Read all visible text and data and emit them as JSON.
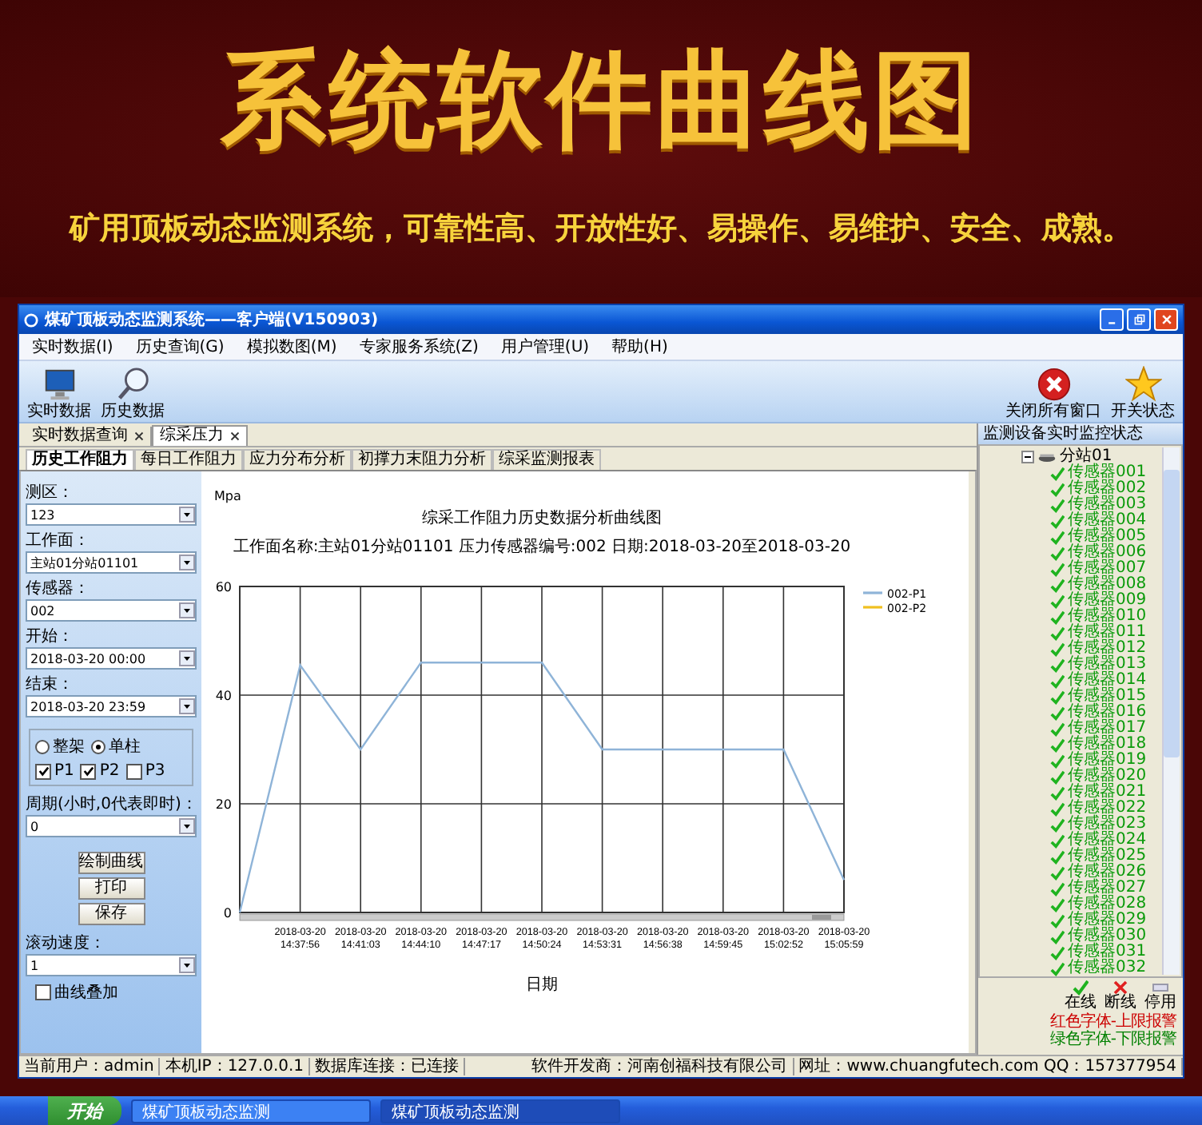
{
  "banner": {
    "title": "系统软件曲线图",
    "subtitle": "矿用顶板动态监测系统，可靠性高、开放性好、易操作、易维护、安全、成熟。"
  },
  "window": {
    "title": "煤矿顶板动态监测系统——客户端(V150903)"
  },
  "menu": [
    "实时数据(I)",
    "历史查询(G)",
    "模拟数图(M)",
    "专家服务系统(Z)",
    "用户管理(U)",
    "帮助(H)"
  ],
  "toolbar": {
    "left": [
      "实时数据",
      "历史数据"
    ],
    "right": [
      "关闭所有窗口",
      "开关状态"
    ]
  },
  "doc_tabs": [
    {
      "label": "实时数据查询",
      "selected": false
    },
    {
      "label": "综采压力",
      "selected": true
    }
  ],
  "sub_tabs": [
    {
      "label": "历史工作阻力",
      "selected": true
    },
    {
      "label": "每日工作阻力",
      "selected": false
    },
    {
      "label": "应力分布分析",
      "selected": false
    },
    {
      "label": "初撑力末阻力分析",
      "selected": false
    },
    {
      "label": "综采监测报表",
      "selected": false
    }
  ],
  "query_form": [
    {
      "kind": "select",
      "label": "测区：",
      "value": "123"
    },
    {
      "kind": "select",
      "label": "工作面：",
      "value": "主站01分站01101"
    },
    {
      "kind": "select",
      "label": "传感器：",
      "value": "002"
    },
    {
      "kind": "select",
      "label": "开始：",
      "value": "2018-03-20 00:00"
    },
    {
      "kind": "select",
      "label": "结束：",
      "value": "2018-03-20 23:59"
    },
    {
      "kind": "options",
      "radios": [
        {
          "label": "整架",
          "selected": false
        },
        {
          "label": "单柱",
          "selected": true
        }
      ],
      "checks": [
        {
          "label": "P1",
          "checked": true
        },
        {
          "label": "P2",
          "checked": true
        },
        {
          "label": "P3",
          "checked": false
        }
      ]
    },
    {
      "kind": "select",
      "label": "周期(小时,0代表即时)：",
      "value": "0"
    },
    {
      "kind": "buttons",
      "buttons": [
        "绘制曲线",
        "打印",
        "保存"
      ]
    },
    {
      "kind": "select",
      "label": "滚动速度：",
      "value": "1"
    },
    {
      "kind": "checkbox",
      "label": "曲线叠加",
      "checked": false
    }
  ],
  "chart_panel": {
    "subtitle": "工作面名称:主站01分站01101  压力传感器编号:002  日期:2018-03-20至2018-03-20",
    "chart_data": {
      "type": "line",
      "title": "综采工作阻力历史数据分析曲线图",
      "annotations": [
        {
          "text": "Mpa"
        }
      ],
      "grid": true,
      "xlabel": "日期",
      "categories": [
        null,
        "2018-03-20 14:37:56",
        "2018-03-20 14:41:03",
        "2018-03-20 14:44:10",
        "2018-03-20 14:47:17",
        "2018-03-20 14:50:24",
        "2018-03-20 14:53:31",
        "2018-03-20 14:56:38",
        "2018-03-20 14:59:45",
        "2018-03-20 15:02:52",
        "2018-03-20 15:05:59"
      ],
      "ylim": [
        0,
        60
      ],
      "yticks": [
        0,
        20,
        40,
        60
      ],
      "series": [
        {
          "name": "002-P1",
          "color": "#8fb4d8",
          "values": [
            0,
            45.5,
            30,
            46,
            46,
            46,
            30,
            30,
            30,
            30,
            6
          ]
        },
        {
          "name": "002-P2",
          "color": "#f0c020",
          "values": [
            null,
            null,
            null,
            null,
            null,
            null,
            null,
            null,
            null,
            null,
            null
          ]
        }
      ]
    }
  },
  "monitor_panel": {
    "title": "监测设备实时监控状态",
    "root": {
      "label": "分站01",
      "expanded": true,
      "children": [
        "传感器001",
        "传感器002",
        "传感器003",
        "传感器004",
        "传感器005",
        "传感器006",
        "传感器007",
        "传感器008",
        "传感器009",
        "传感器010",
        "传感器011",
        "传感器012",
        "传感器013",
        "传感器014",
        "传感器015",
        "传感器016",
        "传感器017",
        "传感器018",
        "传感器019",
        "传感器020",
        "传感器021",
        "传感器022",
        "传感器023",
        "传感器024",
        "传感器025",
        "传感器026",
        "传感器027",
        "传感器028",
        "传感器029",
        "传感器030",
        "传感器031",
        "传感器032"
      ]
    },
    "legend": [
      {
        "kind": "online",
        "label": "在线"
      },
      {
        "kind": "offline",
        "label": "断线"
      },
      {
        "kind": "disabled",
        "label": "停用"
      }
    ],
    "notes": [
      {
        "label": "红色字体-上限报警",
        "color": "#cc0000"
      },
      {
        "label": "绿色字体-下限报警",
        "color": "#008000"
      }
    ]
  },
  "status_bar": [
    "当前用户：admin",
    "本机IP：127.0.0.1",
    "数据库连接：已连接",
    "软件开发商：河南创福科技有限公司",
    "网址：www.chuangfutech.com QQ：157377954"
  ],
  "taskbar": {
    "start": "开始",
    "tasks": [
      {
        "label": "煤矿顶板动态监测",
        "selected": false
      },
      {
        "label": "煤矿顶板动态监测",
        "selected": true
      }
    ]
  }
}
